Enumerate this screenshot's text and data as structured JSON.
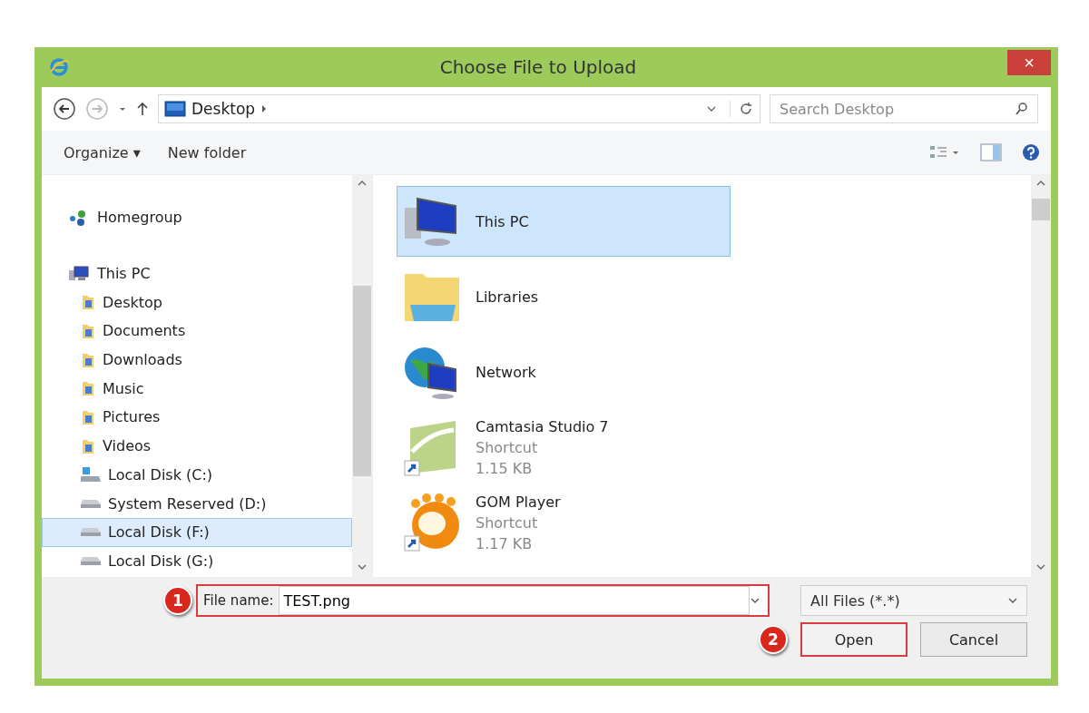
{
  "window": {
    "title": "Choose File to Upload",
    "close": "×"
  },
  "address": {
    "path": "Desktop",
    "search_placeholder": "Search Desktop"
  },
  "toolbar": {
    "organize": "Organize ▾",
    "new_folder": "New folder"
  },
  "sidebar": {
    "items": [
      {
        "label": "Homegroup",
        "kind": "homegroup",
        "selected": false
      },
      {
        "label": "This PC",
        "kind": "pc",
        "selected": false,
        "children": [
          {
            "label": "Desktop",
            "kind": "folder",
            "selected": false
          },
          {
            "label": "Documents",
            "kind": "folder",
            "selected": false
          },
          {
            "label": "Downloads",
            "kind": "folder",
            "selected": false
          },
          {
            "label": "Music",
            "kind": "folder",
            "selected": false
          },
          {
            "label": "Pictures",
            "kind": "folder",
            "selected": false
          },
          {
            "label": "Videos",
            "kind": "folder",
            "selected": false
          },
          {
            "label": "Local Disk (C:)",
            "kind": "system-disk",
            "selected": false
          },
          {
            "label": "System Reserved (D:)",
            "kind": "disk",
            "selected": false
          },
          {
            "label": "Local Disk (F:)",
            "kind": "disk",
            "selected": true
          },
          {
            "label": "Local Disk (G:)",
            "kind": "disk",
            "selected": false
          }
        ]
      }
    ]
  },
  "files": [
    {
      "name": "This PC",
      "kind": "computer",
      "selected": true
    },
    {
      "name": "Libraries",
      "kind": "library",
      "selected": false
    },
    {
      "name": "Network",
      "kind": "network",
      "selected": false
    },
    {
      "name": "Camtasia Studio 7",
      "kind": "camtasia",
      "selected": false,
      "details": [
        "Shortcut",
        "1.15 KB"
      ]
    },
    {
      "name": "GOM Player",
      "kind": "player",
      "selected": false,
      "details": [
        "Shortcut",
        "1.17 KB"
      ]
    }
  ],
  "file_name": {
    "label": "File name:",
    "value": "TEST.png",
    "step": "1",
    "highlighted": true
  },
  "file_type": {
    "value": "All Files (*.*)"
  },
  "buttons": [
    {
      "label": "Open",
      "step": "2",
      "highlighted": true
    },
    {
      "label": "Cancel",
      "highlighted": false
    }
  ]
}
